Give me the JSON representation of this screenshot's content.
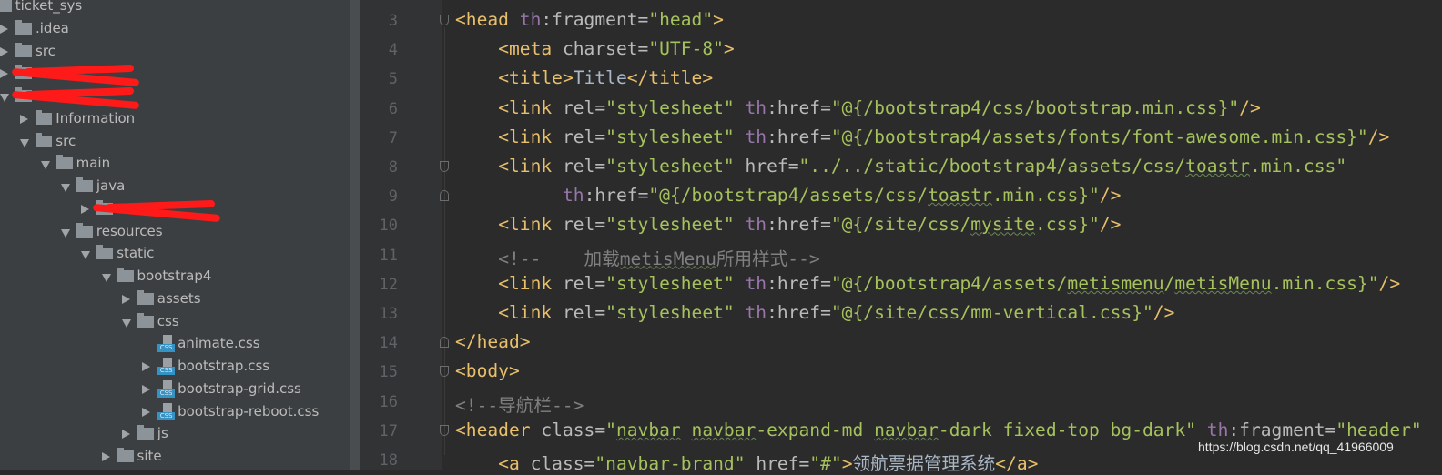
{
  "project_tree": {
    "items": [
      {
        "label": "ticket_sys",
        "level": -1,
        "arrow": "none",
        "icon": "folder-icon"
      },
      {
        "label": ".idea",
        "level": 0,
        "arrow": "closed",
        "icon": "folder-icon"
      },
      {
        "label": "src",
        "level": 0,
        "arrow": "closed",
        "icon": "folder-icon"
      },
      {
        "label": "",
        "level": 0,
        "arrow": "closed",
        "icon": "folder-icon",
        "redacted": true
      },
      {
        "label": "",
        "level": 0,
        "arrow": "open",
        "icon": "folder-icon",
        "redacted": true
      },
      {
        "label": "Information",
        "level": 1,
        "arrow": "closed",
        "icon": "folder-icon"
      },
      {
        "label": "src",
        "level": 1,
        "arrow": "open",
        "icon": "folder-icon"
      },
      {
        "label": "main",
        "level": 2,
        "arrow": "open",
        "icon": "folder-icon"
      },
      {
        "label": "java",
        "level": 3,
        "arrow": "open",
        "icon": "folder-icon"
      },
      {
        "label": "",
        "level": 4,
        "arrow": "closed",
        "icon": "folder-icon",
        "redacted": true
      },
      {
        "label": "resources",
        "level": 3,
        "arrow": "open",
        "icon": "folder-icon"
      },
      {
        "label": "static",
        "level": 4,
        "arrow": "open",
        "icon": "folder-icon"
      },
      {
        "label": "bootstrap4",
        "level": 5,
        "arrow": "open",
        "icon": "folder-icon"
      },
      {
        "label": "assets",
        "level": 6,
        "arrow": "closed",
        "icon": "folder-icon"
      },
      {
        "label": "css",
        "level": 6,
        "arrow": "open",
        "icon": "folder-icon"
      },
      {
        "label": "animate.css",
        "level": 7,
        "arrow": "none",
        "icon": "css-file-icon"
      },
      {
        "label": "bootstrap.css",
        "level": 7,
        "arrow": "closed",
        "icon": "css-file-icon"
      },
      {
        "label": "bootstrap-grid.css",
        "level": 7,
        "arrow": "closed",
        "icon": "css-file-icon"
      },
      {
        "label": "bootstrap-reboot.css",
        "level": 7,
        "arrow": "closed",
        "icon": "css-file-icon"
      },
      {
        "label": "js",
        "level": 6,
        "arrow": "closed",
        "icon": "folder-icon"
      },
      {
        "label": "site",
        "level": 5,
        "arrow": "closed",
        "icon": "folder-icon"
      }
    ],
    "css_icon_label": "CSS"
  },
  "editor": {
    "colors": {
      "tag": "#e8bf6a",
      "attr": "#bababa",
      "string": "#a5c25c",
      "namespace": "#9876aa",
      "text": "#a9b7c6",
      "comment": "#808080"
    },
    "lines": [
      {
        "num": "3",
        "indent": 0,
        "fold": "start",
        "tokens": [
          [
            "tag",
            "<head "
          ],
          [
            "ns",
            "th"
          ],
          [
            "attr",
            ":fragment="
          ],
          [
            "str",
            "\"head\""
          ],
          [
            "tag",
            ">"
          ]
        ]
      },
      {
        "num": "4",
        "indent": 1,
        "tokens": [
          [
            "tag",
            "<meta "
          ],
          [
            "attr",
            "charset="
          ],
          [
            "str",
            "\"UTF-8\""
          ],
          [
            "tag",
            ">"
          ]
        ]
      },
      {
        "num": "5",
        "indent": 1,
        "tokens": [
          [
            "tag",
            "<title>"
          ],
          [
            "txt",
            "Title"
          ],
          [
            "tag",
            "</title>"
          ]
        ]
      },
      {
        "num": "6",
        "indent": 1,
        "tokens": [
          [
            "tag",
            "<link "
          ],
          [
            "attr",
            "rel="
          ],
          [
            "str",
            "\"stylesheet\" "
          ],
          [
            "ns",
            "th"
          ],
          [
            "attr",
            ":href="
          ],
          [
            "str",
            "\"@{/bootstrap4/css/bootstrap.min.css}\""
          ],
          [
            "tag",
            "/>"
          ]
        ]
      },
      {
        "num": "7",
        "indent": 1,
        "tokens": [
          [
            "tag",
            "<link "
          ],
          [
            "attr",
            "rel="
          ],
          [
            "str",
            "\"stylesheet\" "
          ],
          [
            "ns",
            "th"
          ],
          [
            "attr",
            ":href="
          ],
          [
            "str",
            "\"@{/bootstrap4/assets/fonts/font-awesome.min.css}\""
          ],
          [
            "tag",
            "/>"
          ]
        ]
      },
      {
        "num": "8",
        "indent": 1,
        "fold": "start",
        "tokens": [
          [
            "tag",
            "<link "
          ],
          [
            "attr",
            "rel="
          ],
          [
            "str",
            "\"stylesheet\" "
          ],
          [
            "attr",
            "href="
          ],
          [
            "str",
            "\"../../static/bootstrap4/assets/css/"
          ],
          [
            "strsq",
            "toastr"
          ],
          [
            "str",
            ".min.css\""
          ]
        ]
      },
      {
        "num": "9",
        "indent": 2.5,
        "fold": "end",
        "tokens": [
          [
            "ns",
            "th"
          ],
          [
            "attr",
            ":href="
          ],
          [
            "str",
            "\"@{/bootstrap4/assets/css/"
          ],
          [
            "strsq",
            "toastr"
          ],
          [
            "str",
            ".min.css}\""
          ],
          [
            "tag",
            "/>"
          ]
        ]
      },
      {
        "num": "10",
        "indent": 1,
        "tokens": [
          [
            "tag",
            "<link "
          ],
          [
            "attr",
            "rel="
          ],
          [
            "str",
            "\"stylesheet\" "
          ],
          [
            "ns",
            "th"
          ],
          [
            "attr",
            ":href="
          ],
          [
            "str",
            "\"@{/site/css/"
          ],
          [
            "strsq",
            "mysite"
          ],
          [
            "str",
            ".css}\""
          ],
          [
            "tag",
            "/>"
          ]
        ]
      },
      {
        "num": "11",
        "indent": 1,
        "tokens": [
          [
            "cm",
            "<!--    加载"
          ],
          [
            "cmsq",
            "metisMenu"
          ],
          [
            "cm",
            "所用样式-->"
          ]
        ]
      },
      {
        "num": "12",
        "indent": 1,
        "tokens": [
          [
            "tag",
            "<link "
          ],
          [
            "attr",
            "rel="
          ],
          [
            "str",
            "\"stylesheet\" "
          ],
          [
            "ns",
            "th"
          ],
          [
            "attr",
            ":href="
          ],
          [
            "str",
            "\"@{/bootstrap4/assets/"
          ],
          [
            "strsq",
            "metismenu"
          ],
          [
            "str",
            "/"
          ],
          [
            "strsq",
            "metisMenu"
          ],
          [
            "str",
            ".min.css}\""
          ],
          [
            "tag",
            "/>"
          ]
        ]
      },
      {
        "num": "13",
        "indent": 1,
        "tokens": [
          [
            "tag",
            "<link "
          ],
          [
            "attr",
            "rel="
          ],
          [
            "str",
            "\"stylesheet\" "
          ],
          [
            "ns",
            "th"
          ],
          [
            "attr",
            ":href="
          ],
          [
            "str",
            "\"@{/site/css/mm-vertical.css}\""
          ],
          [
            "tag",
            "/>"
          ]
        ]
      },
      {
        "num": "14",
        "indent": 0,
        "fold": "end",
        "tokens": [
          [
            "tag",
            "</head>"
          ]
        ]
      },
      {
        "num": "15",
        "indent": 0,
        "fold": "start",
        "tokens": [
          [
            "tag",
            "<body>"
          ]
        ]
      },
      {
        "num": "16",
        "indent": 0,
        "tokens": [
          [
            "cm",
            "<!--导航栏-->"
          ]
        ]
      },
      {
        "num": "17",
        "indent": 0,
        "fold": "start",
        "tokens": [
          [
            "tag",
            "<header "
          ],
          [
            "attr",
            "class="
          ],
          [
            "str",
            "\""
          ],
          [
            "strsq",
            "navbar"
          ],
          [
            "str",
            " "
          ],
          [
            "strsq",
            "navbar"
          ],
          [
            "str",
            "-expand-md "
          ],
          [
            "strsq",
            "navbar"
          ],
          [
            "str",
            "-dark fixed-top bg-dark\" "
          ],
          [
            "ns",
            "th"
          ],
          [
            "attr",
            ":fragment="
          ],
          [
            "str",
            "\"header\""
          ]
        ]
      },
      {
        "num": "18",
        "indent": 1,
        "tokens": [
          [
            "tag",
            "<a "
          ],
          [
            "attr",
            "class="
          ],
          [
            "str",
            "\"navbar-brand\" "
          ],
          [
            "attr",
            "href="
          ],
          [
            "str",
            "\"#\""
          ],
          [
            "tag",
            ">"
          ],
          [
            "txt",
            "领航票据管理系统"
          ],
          [
            "tag",
            "</a>"
          ]
        ]
      }
    ]
  },
  "watermark": "https://blog.csdn.net/qq_41966009"
}
